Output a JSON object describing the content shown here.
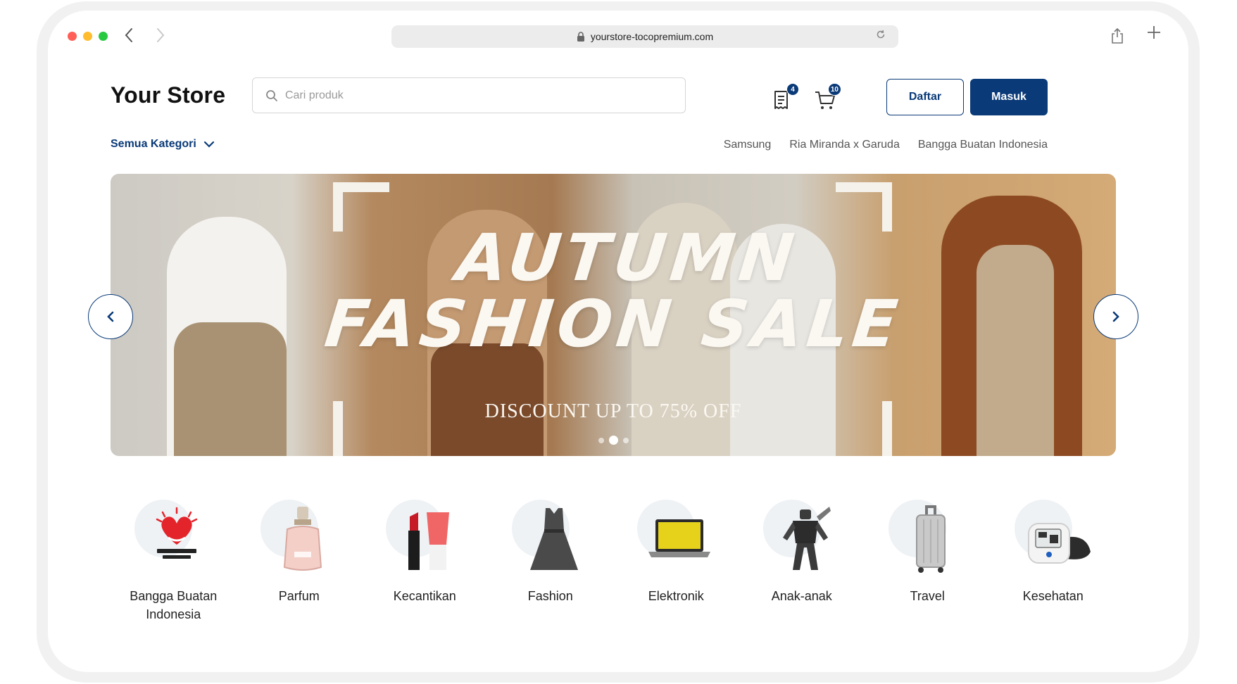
{
  "browser": {
    "url": "yourstore-tocopremium.com",
    "traffic_lights": [
      "#ff5f57",
      "#febc2e",
      "#28c840"
    ]
  },
  "header": {
    "logo": "Your Store",
    "search_placeholder": "Cari produk",
    "transactions_badge": "4",
    "cart_badge": "10",
    "register_label": "Daftar",
    "login_label": "Masuk",
    "category_dropdown": "Semua Kategori",
    "quick_links": [
      "Samsung",
      "Ria Miranda x Garuda",
      "Bangga Buatan Indonesia"
    ]
  },
  "banner": {
    "title_line1": "AUTUMN",
    "title_line2": "FASHION SALE",
    "subtitle": "DISCOUNT UP TO 75% OFF",
    "slide_count": 3,
    "active_slide": 2
  },
  "categories": [
    {
      "label": "Bangga Buatan Indonesia",
      "icon": "bangga-buatan-indonesia-logo",
      "logo_text": "BANGGA BUATAN INDONESIA"
    },
    {
      "label": "Parfum",
      "icon": "perfume-bottle"
    },
    {
      "label": "Kecantikan",
      "icon": "lipstick-cosmetics"
    },
    {
      "label": "Fashion",
      "icon": "dress"
    },
    {
      "label": "Elektronik",
      "icon": "laptop"
    },
    {
      "label": "Anak-anak",
      "icon": "robot-toy"
    },
    {
      "label": "Travel",
      "icon": "suitcase"
    },
    {
      "label": "Kesehatan",
      "icon": "blood-pressure-monitor"
    }
  ],
  "colors": {
    "primary": "#0a3a78",
    "category_circle": "#eef2f5"
  }
}
